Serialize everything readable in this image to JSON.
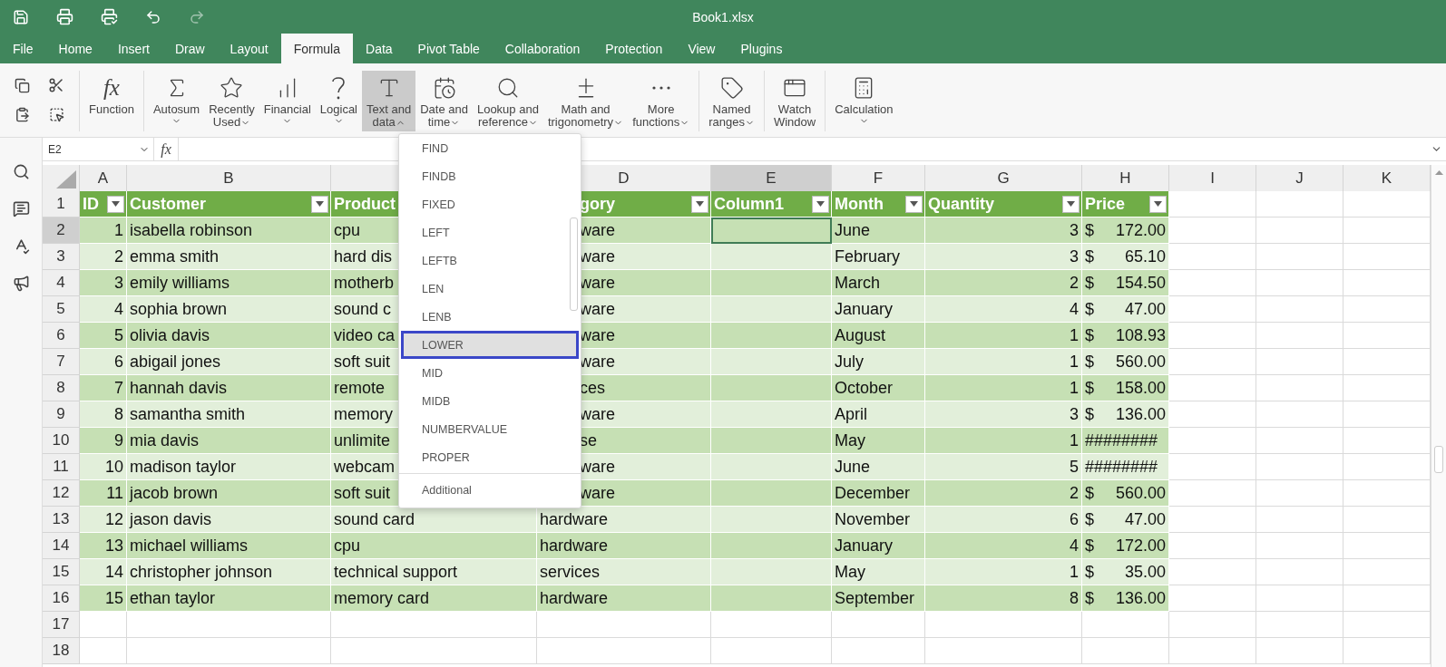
{
  "window": {
    "title": "Book1.xlsx"
  },
  "tabs": [
    {
      "label": "File",
      "selected": false
    },
    {
      "label": "Home",
      "selected": false
    },
    {
      "label": "Insert",
      "selected": false
    },
    {
      "label": "Draw",
      "selected": false
    },
    {
      "label": "Layout",
      "selected": false
    },
    {
      "label": "Formula",
      "selected": true
    },
    {
      "label": "Data",
      "selected": false
    },
    {
      "label": "Pivot Table",
      "selected": false
    },
    {
      "label": "Collaboration",
      "selected": false
    },
    {
      "label": "Protection",
      "selected": false
    },
    {
      "label": "View",
      "selected": false
    },
    {
      "label": "Plugins",
      "selected": false
    }
  ],
  "ribbon": {
    "function_button": {
      "icon_text": "fx",
      "label": "Function"
    },
    "groups": [
      [
        {
          "lines": [
            "Autosum"
          ],
          "menu": true,
          "open": false
        },
        {
          "lines": [
            "Recently",
            "Used"
          ],
          "menu": true,
          "open": false
        },
        {
          "lines": [
            "Financial"
          ],
          "menu": true,
          "open": false
        },
        {
          "lines": [
            "Logical"
          ],
          "menu": true,
          "open": false
        },
        {
          "lines": [
            "Text and",
            "data"
          ],
          "menu": true,
          "open": true
        },
        {
          "lines": [
            "Date and",
            "time"
          ],
          "menu": true,
          "open": false
        },
        {
          "lines": [
            "Lookup and",
            "reference"
          ],
          "menu": true,
          "open": false
        },
        {
          "lines": [
            "Math and",
            "trigonometry"
          ],
          "menu": true,
          "open": false
        },
        {
          "lines": [
            "More",
            "functions"
          ],
          "menu": true,
          "open": false
        }
      ],
      [
        {
          "lines": [
            "Named",
            "ranges"
          ],
          "menu": true,
          "open": false
        }
      ],
      [
        {
          "lines": [
            "Watch",
            "Window"
          ],
          "menu": false,
          "open": false
        }
      ],
      [
        {
          "lines": [
            "Calculation"
          ],
          "menu": true,
          "open": false
        }
      ]
    ]
  },
  "formula_bar": {
    "cell_name": "E2",
    "icon_text": "fx"
  },
  "sheet": {
    "column_letters": [
      {
        "label": "A",
        "selected": false
      },
      {
        "label": "B",
        "selected": false
      },
      {
        "selected": false
      },
      {
        "label": "D",
        "selected": false
      },
      {
        "label": "E",
        "selected": true
      },
      {
        "label": "F",
        "selected": false
      },
      {
        "label": "G",
        "selected": false
      },
      {
        "label": "H",
        "selected": false
      },
      {
        "label": "I",
        "selected": false
      },
      {
        "label": "J",
        "selected": false
      },
      {
        "label": "K",
        "selected": false
      }
    ],
    "row_numbers": [
      {
        "label": "1",
        "selected": false
      },
      {
        "label": "2",
        "selected": true
      },
      {
        "label": "3",
        "selected": false
      },
      {
        "label": "4",
        "selected": false
      },
      {
        "label": "5",
        "selected": false
      },
      {
        "label": "6",
        "selected": false
      },
      {
        "label": "7",
        "selected": false
      },
      {
        "label": "8",
        "selected": false
      },
      {
        "label": "9",
        "selected": false
      },
      {
        "label": "10",
        "selected": false
      },
      {
        "label": "11",
        "selected": false
      },
      {
        "label": "12",
        "selected": false
      },
      {
        "label": "13",
        "selected": false
      },
      {
        "label": "14",
        "selected": false
      },
      {
        "label": "15",
        "selected": false
      },
      {
        "label": "16",
        "selected": false
      },
      {
        "label": "17",
        "selected": false
      },
      {
        "label": "18",
        "selected": false
      }
    ],
    "table": {
      "columns": [
        {
          "label": "ID",
          "kind": "number"
        },
        {
          "label": "Customer",
          "kind": "text"
        },
        {
          "label": "Product",
          "kind": "text"
        },
        {
          "label": "gory",
          "kind": "text"
        },
        {
          "label": "Column1",
          "kind": "text"
        },
        {
          "label": "Month",
          "kind": "text"
        },
        {
          "label": "Quantity",
          "kind": "number"
        },
        {
          "label": "Price",
          "kind": "money"
        }
      ],
      "rows": [
        [
          "1",
          "isabella robinson",
          "cpu",
          "ware",
          "",
          "June",
          "3",
          "$ 172.00"
        ],
        [
          "2",
          "emma smith",
          "hard dis",
          "ware",
          "",
          "February",
          "3",
          "$ 65.10"
        ],
        [
          "3",
          "emily williams",
          "motherb",
          "ware",
          "",
          "March",
          "2",
          "$ 154.50"
        ],
        [
          "4",
          "sophia brown",
          "sound c",
          "ware",
          "",
          "January",
          "4",
          "$ 47.00"
        ],
        [
          "5",
          "olivia davis",
          "video ca",
          "ware",
          "",
          "August",
          "1",
          "$ 108.93"
        ],
        [
          "6",
          "abigail jones",
          "soft suit",
          "ware",
          "",
          "July",
          "1",
          "$ 560.00"
        ],
        [
          "7",
          "hannah davis",
          "remote",
          "ces",
          "",
          "October",
          "1",
          "$ 158.00"
        ],
        [
          "8",
          "samantha smith",
          "memory",
          "ware",
          "",
          "April",
          "3",
          "$ 136.00"
        ],
        [
          "9",
          "mia davis",
          "unlimite",
          "se",
          "",
          "May",
          "1",
          "########"
        ],
        [
          "10",
          "madison taylor",
          "webcam",
          "ware",
          "",
          "June",
          "5",
          "########"
        ],
        [
          "11",
          "jacob brown",
          "soft suit",
          "ware",
          "",
          "December",
          "2",
          "$ 560.00"
        ],
        [
          "12",
          "jason davis",
          "sound card",
          "hardware",
          "",
          "November",
          "6",
          "$ 47.00"
        ],
        [
          "13",
          "michael williams",
          "cpu",
          "hardware",
          "",
          "January",
          "4",
          "$ 172.00"
        ],
        [
          "14",
          "christopher johnson",
          "technical support",
          "services",
          "",
          "May",
          "1",
          "$ 35.00"
        ],
        [
          "15",
          "ethan taylor",
          "memory card",
          "hardware",
          "",
          "September",
          "8",
          "$ 136.00"
        ]
      ]
    }
  },
  "function_menu": {
    "items": [
      {
        "label": "FIND",
        "selected": false
      },
      {
        "label": "FINDB",
        "selected": false
      },
      {
        "label": "FIXED",
        "selected": false
      },
      {
        "label": "LEFT",
        "selected": false
      },
      {
        "label": "LEFTB",
        "selected": false
      },
      {
        "label": "LEN",
        "selected": false
      },
      {
        "label": "LENB",
        "selected": false
      },
      {
        "label": "LOWER",
        "selected": true
      },
      {
        "label": "MID",
        "selected": false
      },
      {
        "label": "MIDB",
        "selected": false
      },
      {
        "label": "NUMBERVALUE",
        "selected": false
      },
      {
        "label": "PROPER",
        "selected": false
      }
    ],
    "footer": "Additional"
  }
}
